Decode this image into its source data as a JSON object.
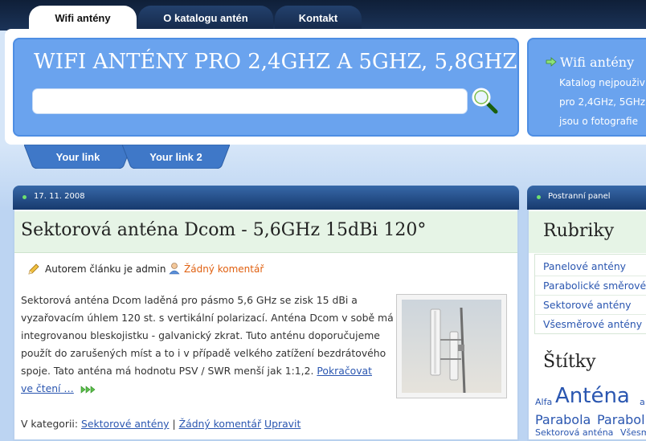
{
  "nav": {
    "tabs": [
      {
        "label": "Wifi antény"
      },
      {
        "label": "O katalogu antén"
      },
      {
        "label": "Kontakt"
      }
    ]
  },
  "header": {
    "site_title": "WIFI ANTÉNY PRO 2,4GHZ A 5GHZ, 5,8GHZ",
    "search": {
      "value": "",
      "placeholder": ""
    },
    "info": {
      "title": "Wifi antény",
      "lines": [
        "Katalog nejpouživ",
        "pro 2,4GHz, 5GHz",
        "jsou o fotografie"
      ]
    }
  },
  "subnav": {
    "links": [
      {
        "label": "Your link"
      },
      {
        "label": "Your link 2"
      }
    ]
  },
  "post": {
    "date": "17. 11. 2008",
    "title": "Sektorová anténa Dcom - 5,6GHz 15dBi 120°",
    "author": "Autorem článku je admin",
    "comments": "Žádný komentář",
    "body_lines": [
      "Sektorová anténa Dcom laděná pro pásmo 5,6 GHz se zisk 15 dBi a",
      "vyzařovacím úhlem 120 st. s vertikální polarizací. Anténa Dcom v sobě má",
      "integrovanou bleskojistku - galvanický zkrat. Tuto anténu doporučujeme",
      "použít do zarušených míst a to i v případě velkého zatížení bezdrátového",
      "spoje. Tato anténa má hodnotu PSV / SWR menší jak 1:1,2. "
    ],
    "read_more_1": "Pokračovat",
    "read_more_2": "ve čtení …",
    "category_label": "V kategorii:",
    "category_link": "Sektorové antény",
    "separator": "|",
    "footer_comments": "Žádný komentář",
    "edit_label": "Upravit"
  },
  "sidebar": {
    "bar_title": "Postranní panel",
    "rubriky_heading": "Rubriky",
    "rubriky": [
      {
        "label": "Panelové antény"
      },
      {
        "label": "Parabolické směrové"
      },
      {
        "label": "Sektorové antény"
      },
      {
        "label": "Všesměrové antény"
      }
    ],
    "tags_heading": "Štítky",
    "tags": [
      {
        "label": "Alfa"
      },
      {
        "label": "Anténa"
      },
      {
        "label": "a"
      },
      {
        "label": "Parabola"
      },
      {
        "label": "Parabol"
      },
      {
        "label": "Sektorová anténa"
      },
      {
        "label": "Všesm"
      }
    ]
  },
  "colors": {
    "dark_nav": "#15294a",
    "panel_blue": "#6aa3ee",
    "link_blue": "#2a56b0",
    "comment_orange": "#e06010",
    "title_green_bg": "#e6f4e6"
  }
}
